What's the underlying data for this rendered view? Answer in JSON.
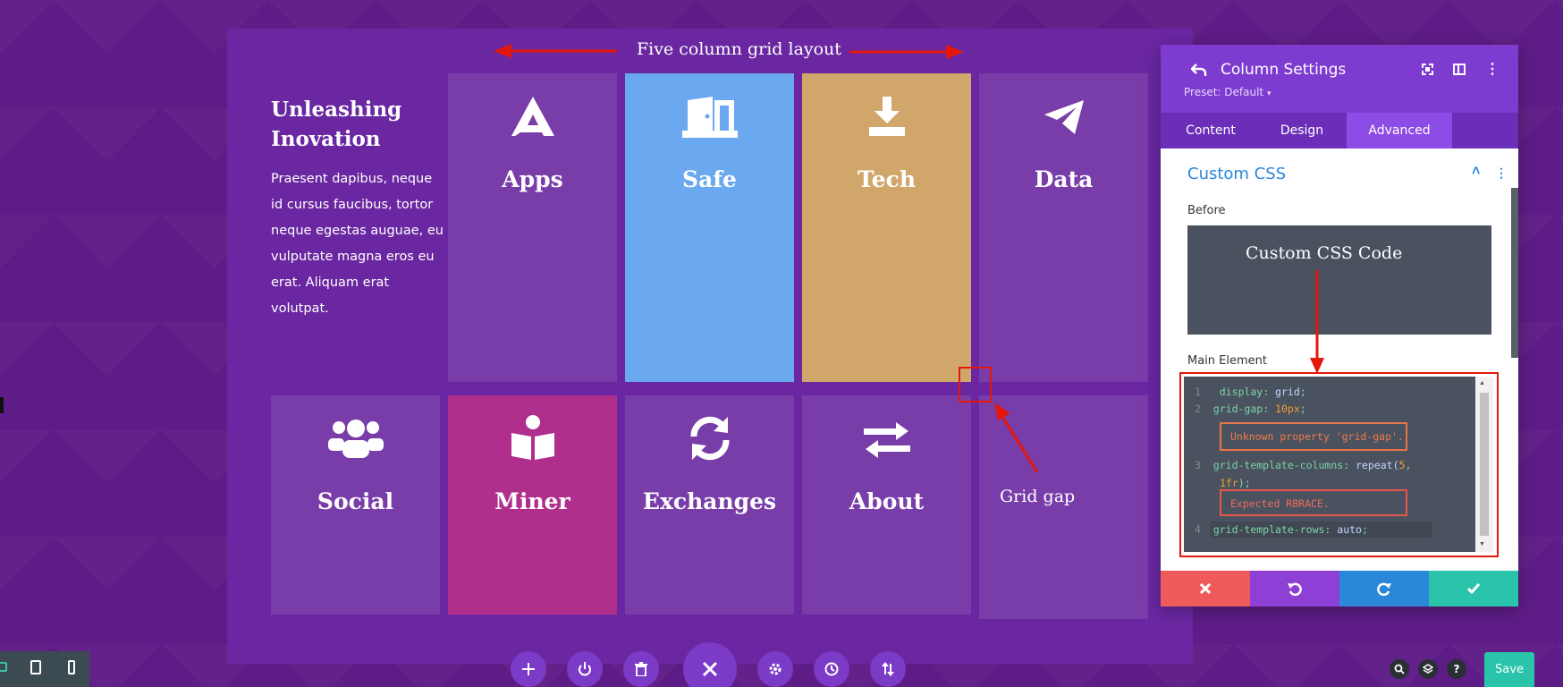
{
  "colors": {
    "page_bg": "#5e1d86",
    "section_bg": "#6a27a1",
    "cell_overlay": "rgba(255,255,255,0.10)",
    "safe": "#6aa8ef",
    "tech": "#d1a66b",
    "miner": "#b02e8c",
    "panel_header": "#7e3bd0",
    "panel_tabs": "#6c2eb9",
    "link_blue": "#2b87da",
    "code_bg": "#4a5260",
    "annotation_red": "#e3170a",
    "cancel": "#ef5b5b",
    "undo": "#8e3fd6",
    "redo": "#2b87da",
    "confirm": "#29c4a9",
    "save": "#29c4a9"
  },
  "annotations": {
    "top": "Five column grid layout",
    "css_code": "Custom CSS Code",
    "grid_gap": "Grid gap"
  },
  "intro": {
    "title": "Unleashing Inovation",
    "text": "Praesent dapibus, neque id cursus faucibus, tortor neque egestas auguae, eu vulputate magna eros eu erat. Aliquam erat volutpat."
  },
  "grid": {
    "row1": [
      {
        "label": "Apps",
        "icon": "apps-logo-icon"
      },
      {
        "label": "Safe",
        "icon": "door-icon"
      },
      {
        "label": "Tech",
        "icon": "download-icon"
      },
      {
        "label": "Data",
        "icon": "paper-plane-icon"
      }
    ],
    "row2": [
      {
        "label": "Social",
        "icon": "users-icon"
      },
      {
        "label": "Miner",
        "icon": "book-reader-icon"
      },
      {
        "label": "Exchanges",
        "icon": "sync-icon"
      },
      {
        "label": "About",
        "icon": "exchange-arrows-icon"
      }
    ]
  },
  "toolbar": {
    "add": "add-icon",
    "power": "power-icon",
    "delete": "trash-icon",
    "close": "close-icon",
    "settings": "gear-icon",
    "history": "clock-icon",
    "reorder": "sort-icon"
  },
  "panel": {
    "title": "Column Settings",
    "preset": "Preset: Default",
    "tabs": [
      "Content",
      "Design",
      "Advanced"
    ],
    "active_tab": "Advanced",
    "section_title": "Custom CSS",
    "before_label": "Before",
    "main_label": "Main Element",
    "code": {
      "l1_num": "1",
      "l1_prop": "display",
      "l1_val": "grid",
      "l2_num": "2",
      "l2_prop": "grid-gap",
      "l2_val": "10px",
      "err1": "Unknown property 'grid-gap'.",
      "l3_num": "3",
      "l3_prop": "grid-template-columns",
      "l3_fn": "repeat(",
      "l3_n": "5",
      "l3_fr": "1fr",
      "err2": "Expected RBRACE.",
      "l4_num": "4",
      "l4_prop": "grid-template-rows",
      "l4_val": "auto"
    }
  },
  "bottom_right": {
    "save_label": "Save"
  }
}
